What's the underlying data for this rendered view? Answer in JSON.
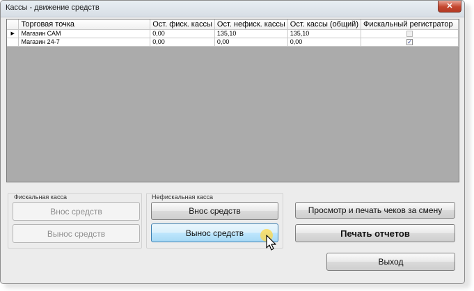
{
  "window": {
    "title": "Кассы - движение средств",
    "close_glyph": "✕"
  },
  "grid": {
    "columns": [
      "Торговая точка",
      "Ост. фиск. кассы",
      "Ост. нефиск. кассы",
      "Ост. кассы (общий)",
      "Фискальный регистратор"
    ],
    "rows": [
      {
        "indicator": "▶",
        "name": "Магазин САМ",
        "fisc": "0,00",
        "nonfisc": "135,10",
        "total": "135,10",
        "registrar_checked": false
      },
      {
        "indicator": "",
        "name": "Магазин 24-7",
        "fisc": "0,00",
        "nonfisc": "0,00",
        "total": "0,00",
        "registrar_checked": true
      }
    ],
    "check_glyph": "✓"
  },
  "fiscal": {
    "label": "Фискальная касса",
    "deposit": "Внос средств",
    "withdraw": "Вынос средств"
  },
  "nonfiscal": {
    "label": "Нефискальная касса",
    "deposit": "Внос средств",
    "withdraw": "Вынос средств"
  },
  "actions": {
    "view_print_checks": "Просмотр и печать чеков за смену",
    "print_reports": "Печать отчетов",
    "exit": "Выход"
  },
  "icons": {
    "cursor": "pointer-cursor-icon",
    "row_indicator": "row-indicator-icon",
    "close": "close-icon"
  },
  "colors": {
    "hot_button": "#bee6fd",
    "close_button": "#c4472f",
    "grid_background": "#ababab"
  }
}
